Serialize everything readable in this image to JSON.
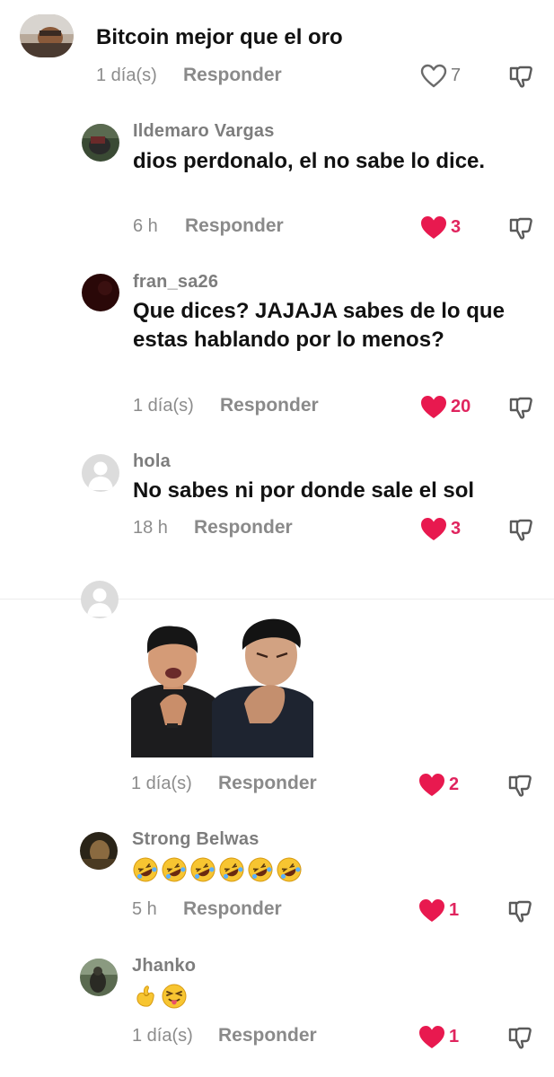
{
  "comments": [
    {
      "username": "",
      "text": "Bitcoin mejor que el oro",
      "time": "1 día(s)",
      "reply": "Responder",
      "likes": "7",
      "liked": false
    },
    {
      "username": "Ildemaro Vargas",
      "text": "dios perdonalo, el no sabe lo dice.",
      "time": "6 h",
      "reply": "Responder",
      "likes": "3",
      "liked": true
    },
    {
      "username": "fran_sa26",
      "text": "Que dices? JAJAJA sabes de lo que estas hablando por lo menos?",
      "time": "1 día(s)",
      "reply": "Responder",
      "likes": "20",
      "liked": true
    },
    {
      "username": "hola",
      "text": "No sabes ni por donde sale el sol",
      "time": "18 h",
      "reply": "Responder",
      "likes": "3",
      "liked": true
    },
    {
      "username": "",
      "text": "",
      "time": "1 día(s)",
      "reply": "Responder",
      "likes": "2",
      "liked": true
    },
    {
      "username": "Strong Belwas",
      "text": "",
      "emojis": [
        "rolling-laughing-emoji",
        "rolling-laughing-emoji",
        "rolling-laughing-emoji",
        "rolling-laughing-emoji",
        "rolling-laughing-emoji",
        "rolling-laughing-emoji"
      ],
      "time": "5 h",
      "reply": "Responder",
      "likes": "1",
      "liked": true
    },
    {
      "username": "Jhanko",
      "text": "",
      "emojis": [
        "pinching-hand-emoji",
        "tongue-out-emoji"
      ],
      "time": "1 día(s)",
      "reply": "Responder",
      "likes": "1",
      "liked": true
    }
  ],
  "colors": {
    "accent": "#e0245e",
    "username": "#7d7d7d",
    "text": "#111111",
    "meta": "#8c8c8c"
  },
  "icons": {
    "like": "heart-icon",
    "dislike": "thumbs-down-icon"
  }
}
